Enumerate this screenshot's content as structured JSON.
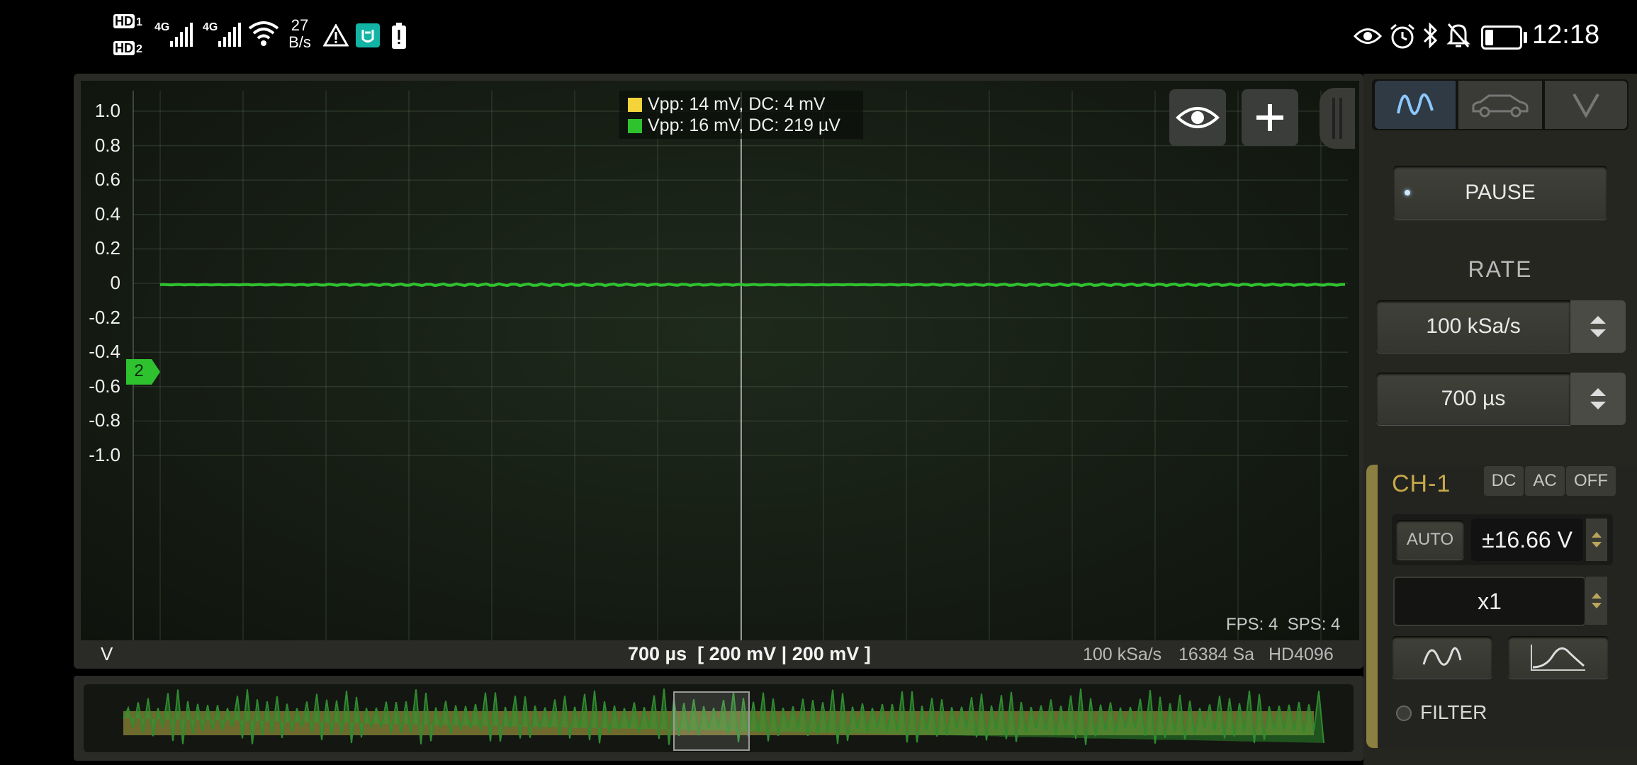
{
  "status_bar": {
    "hd1": "HD",
    "hd1_sub": "1",
    "hd2": "HD",
    "hd2_sub": "2",
    "net1": "4G",
    "net2": "4G",
    "speed_value": "27",
    "speed_unit": "B/s",
    "battery_level": 0.25,
    "time": "12:18"
  },
  "scope": {
    "y_axis": {
      "ticks": [
        "1.0",
        "0.8",
        "0.6",
        "0.4",
        "0.2",
        "0",
        "-0.2",
        "-0.4",
        "-0.6",
        "-0.8",
        "-1.0"
      ],
      "unit": "V"
    },
    "legend": [
      {
        "text": "Vpp: 14 mV, DC: 4 mV",
        "color": "#f5d33a"
      },
      {
        "text": "Vpp: 16 mV, DC: 219 µV",
        "color": "#2fc22f"
      }
    ],
    "channel_marker": "2",
    "fps_text": "FPS: 4  SPS: 4",
    "timebase_text": "700 µs  [ 200 mV | 200 mV ]",
    "info": {
      "rate": "100 kSa/s",
      "samples": "16384 Sa",
      "mode": "HD4096"
    }
  },
  "right_panel": {
    "pause_label": "PAUSE",
    "rate_label": "RATE",
    "rate_value": "100 kSa/s",
    "time_value": "700 µs",
    "channel": {
      "name": "CH-1",
      "coupling_tabs": [
        "DC",
        "AC",
        "OFF"
      ],
      "auto_label": "AUTO",
      "range_value": "±16.66 V",
      "probe_value": "x1",
      "filter_label": "FILTER"
    }
  },
  "colors": {
    "ch1": "#f5d33a",
    "ch2": "#2fc22f",
    "ch1_label": "#c8a94a"
  }
}
